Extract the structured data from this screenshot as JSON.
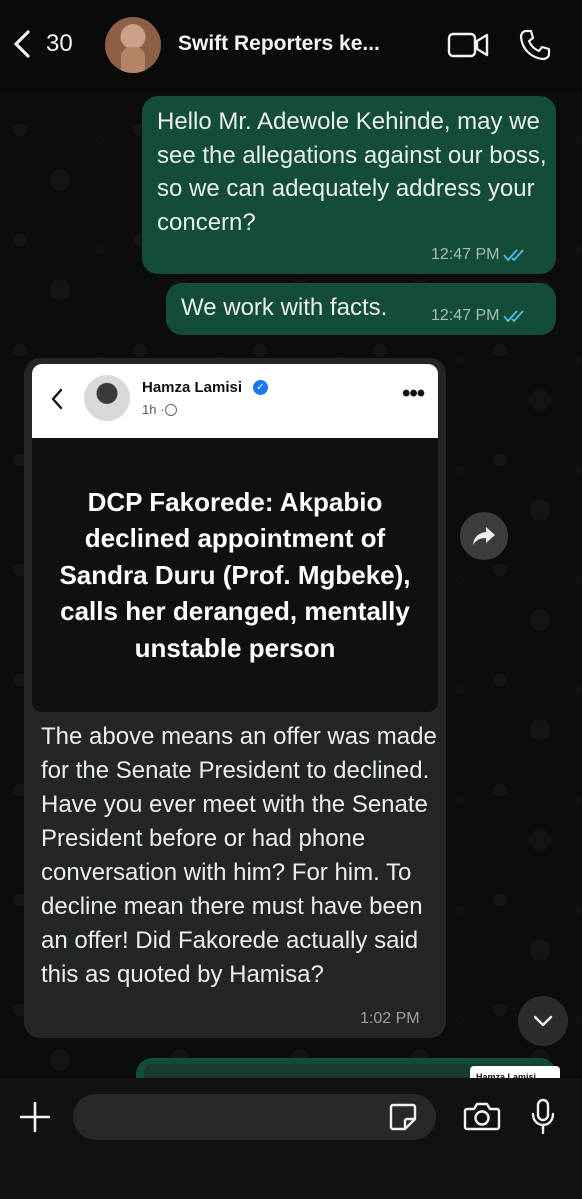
{
  "header": {
    "back_count": "30",
    "chat_title": "Swift Reporters ke...",
    "icons": [
      "back-chevron-icon",
      "video-call-icon",
      "phone-call-icon"
    ]
  },
  "messages": {
    "out1": {
      "text": "Hello Mr. Adewole Kehinde, may we see the allegations against our boss, so we can adequately address your concern?",
      "time": "12:47 PM"
    },
    "out2": {
      "text": "We work with facts.",
      "time": "12:47 PM"
    },
    "in1": {
      "fb_post": {
        "author": "Hamza Lamisi",
        "meta": "1h ·",
        "headline": "DCP Fakorede: Akpabio declined appointment of Sandra Duru (Prof. Mgbeke), calls her deranged, mentally unstable person"
      },
      "text": "The above means an offer was made for the Senate President to declined. Have you ever meet with the Senate President before or had phone conversation with him? For him. To decline mean there must have been an offer! Did Fakorede actually said this as quoted by Hamisa?",
      "time": "1:02 PM"
    },
    "next_preview": {
      "author": "Hamza Lamisi"
    }
  },
  "composer": {
    "placeholder": ""
  },
  "colors": {
    "outgoing_bubble": "#144d37",
    "incoming_bubble": "#232626",
    "read_ticks": "#53bdeb",
    "background": "#0b0b0b"
  }
}
